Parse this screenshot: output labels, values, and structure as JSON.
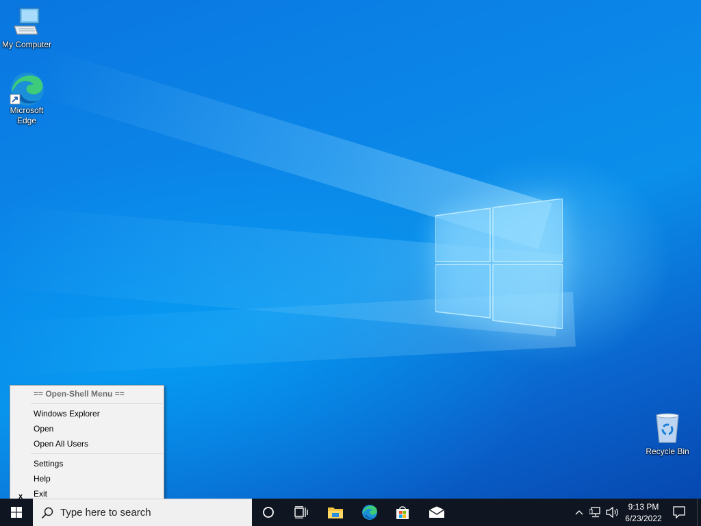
{
  "desktop": {
    "icons": [
      {
        "label": "My Computer",
        "icon": "computer-icon"
      },
      {
        "label": "Microsoft Edge",
        "icon": "edge-icon"
      },
      {
        "label": "Recycle Bin",
        "icon": "recycle-bin-icon"
      }
    ],
    "edge_label_line1": "Microsoft",
    "edge_label_line2": "Edge"
  },
  "context_menu": {
    "header": "== Open-Shell Menu ==",
    "items": [
      {
        "label": "Windows Explorer"
      },
      {
        "label": "Open"
      },
      {
        "label": "Open All Users"
      },
      {
        "label": "Settings"
      },
      {
        "label": "Help"
      },
      {
        "label": "Exit",
        "mark": "x"
      }
    ]
  },
  "taskbar": {
    "search_placeholder": "Type here to search",
    "pinned": [
      "cortana-icon",
      "task-view-icon",
      "file-explorer-icon",
      "edge-icon",
      "store-icon",
      "mail-icon"
    ],
    "clock_time": "9:13 PM",
    "clock_date": "6/23/2022"
  },
  "colors": {
    "accent": "#0a78d7",
    "taskbar": "#101621",
    "menu_bg": "#f2f2f2"
  }
}
